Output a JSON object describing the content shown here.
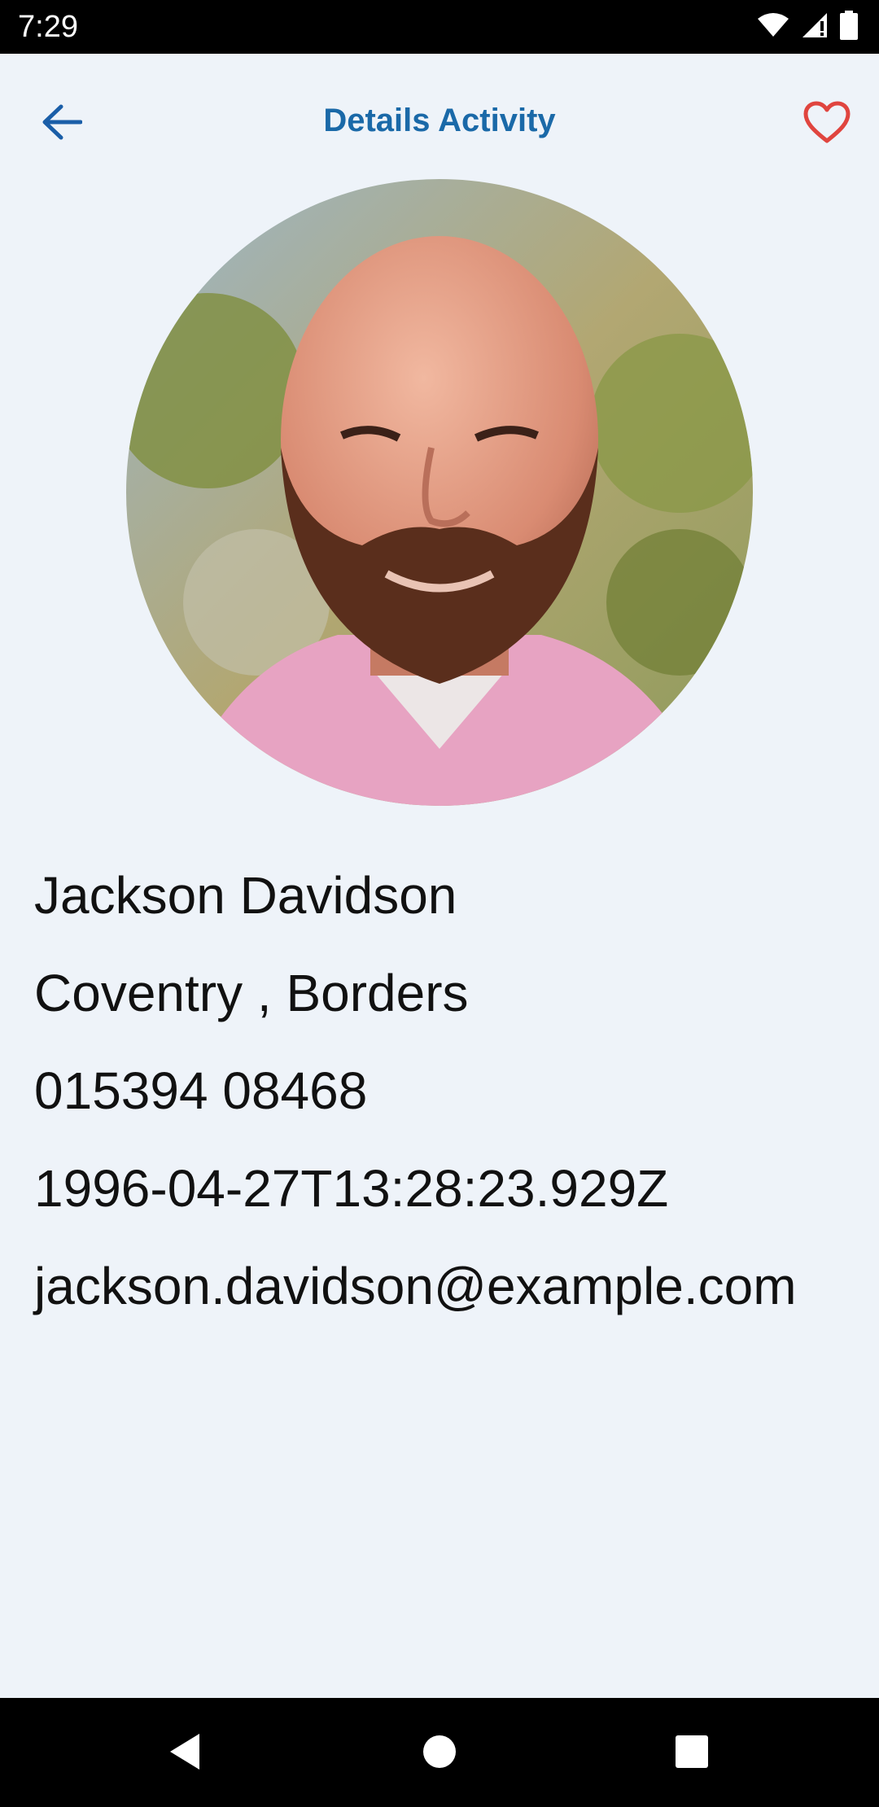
{
  "status_bar": {
    "time": "7:29",
    "icons": [
      "wifi-icon",
      "signal-icon",
      "battery-icon"
    ]
  },
  "app_bar": {
    "title": "Details Activity",
    "back_icon": "arrow-back-icon",
    "favorite_icon": "heart-outline-icon",
    "title_color": "#1a69a8",
    "favorite_color": "#e0453f"
  },
  "profile": {
    "avatar": "profile-photo",
    "name": "Jackson Davidson",
    "location": "Coventry , Borders",
    "phone": "015394 08468",
    "date": "1996-04-27T13:28:23.929Z",
    "email": "jackson.davidson@example.com"
  },
  "nav_bar": {
    "icons": [
      "back-triangle-icon",
      "home-circle-icon",
      "recents-square-icon"
    ]
  },
  "colors": {
    "background": "#eef3f9",
    "system_bars": "#000000"
  }
}
